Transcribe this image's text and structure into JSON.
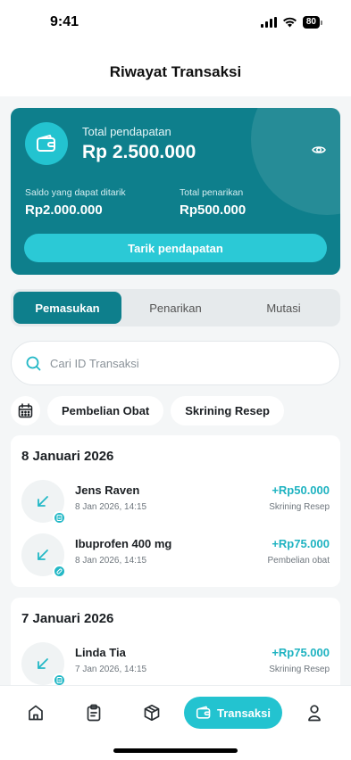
{
  "status_bar": {
    "time": "9:41",
    "battery": "80"
  },
  "header": {
    "title": "Riwayat Transaksi"
  },
  "balance_card": {
    "total_label": "Total pendapatan",
    "total_value": "Rp 2.500.000",
    "withdrawable_label": "Saldo yang dapat ditarik",
    "withdrawable_value": "Rp2.000.000",
    "withdrawn_label": "Total penarikan",
    "withdrawn_value": "Rp500.000",
    "withdraw_button": "Tarik pendapatan"
  },
  "tabs": [
    {
      "label": "Pemasukan",
      "active": true
    },
    {
      "label": "Penarikan",
      "active": false
    },
    {
      "label": "Mutasi",
      "active": false
    }
  ],
  "search": {
    "placeholder": "Cari ID Transaksi"
  },
  "filters": {
    "chips": [
      "Pembelian Obat",
      "Skrining Resep"
    ]
  },
  "groups": [
    {
      "date": "8 Januari 2026",
      "transactions": [
        {
          "name": "Jens Raven",
          "time": "8 Jan 2026, 14:15",
          "amount": "+Rp50.000",
          "category": "Skrining Resep",
          "badge_icon": "screening-icon"
        },
        {
          "name": "Ibuprofen 400 mg",
          "time": "8 Jan 2026, 14:15",
          "amount": "+Rp75.000",
          "category": "Pembelian obat",
          "badge_icon": "pill-icon"
        }
      ]
    },
    {
      "date": "7 Januari 2026",
      "transactions": [
        {
          "name": "Linda Tia",
          "time": "7 Jan 2026, 14:15",
          "amount": "+Rp75.000",
          "category": "Skrining Resep",
          "badge_icon": "screening-icon"
        }
      ]
    }
  ],
  "bottom_nav": {
    "items": [
      "home-icon",
      "clipboard-icon",
      "box-icon",
      "wallet-icon",
      "profile-icon"
    ],
    "active_label": "Transaksi"
  },
  "colors": {
    "primary": "#0e7f8c",
    "accent": "#23c3d0",
    "amount": "#1fb3c1"
  }
}
